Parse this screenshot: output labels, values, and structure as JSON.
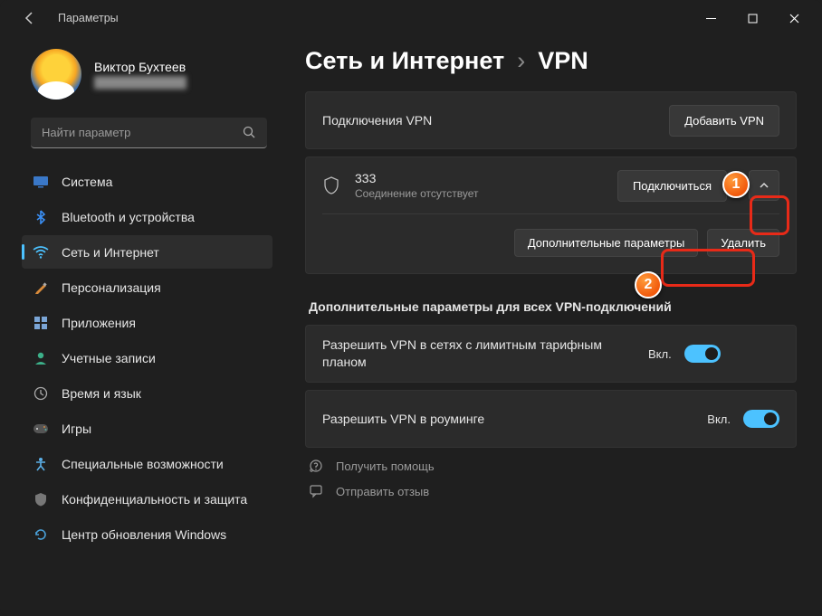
{
  "window": {
    "title": "Параметры"
  },
  "user": {
    "name": "Виктор Бухтеев",
    "email": "████████████"
  },
  "search": {
    "placeholder": "Найти параметр"
  },
  "nav": [
    {
      "id": "system",
      "label": "Система",
      "selected": false
    },
    {
      "id": "bluetooth",
      "label": "Bluetooth и устройства",
      "selected": false
    },
    {
      "id": "network",
      "label": "Сеть и Интернет",
      "selected": true
    },
    {
      "id": "personalization",
      "label": "Персонализация",
      "selected": false
    },
    {
      "id": "apps",
      "label": "Приложения",
      "selected": false
    },
    {
      "id": "accounts",
      "label": "Учетные записи",
      "selected": false
    },
    {
      "id": "time",
      "label": "Время и язык",
      "selected": false
    },
    {
      "id": "gaming",
      "label": "Игры",
      "selected": false
    },
    {
      "id": "accessibility",
      "label": "Специальные возможности",
      "selected": false
    },
    {
      "id": "privacy",
      "label": "Конфиденциальность и защита",
      "selected": false
    },
    {
      "id": "update",
      "label": "Центр обновления Windows",
      "selected": false
    }
  ],
  "breadcrumb": {
    "parent": "Сеть и Интернет",
    "current": "VPN"
  },
  "cards": {
    "connections": {
      "title": "Подключения VPN",
      "add": "Добавить VPN"
    },
    "item": {
      "name": "333",
      "status": "Соединение отсутствует",
      "connect": "Подключиться",
      "extra": "Дополнительные параметры",
      "delete": "Удалить"
    }
  },
  "section_title": "Дополнительные параметры для всех VPN-подключений",
  "options": [
    {
      "label": "Разрешить VPN в сетях с лимитным тарифным планом",
      "state": "Вкл."
    },
    {
      "label": "Разрешить VPN в роуминге",
      "state": "Вкл."
    }
  ],
  "links": {
    "help": "Получить помощь",
    "feedback": "Отправить отзыв"
  }
}
